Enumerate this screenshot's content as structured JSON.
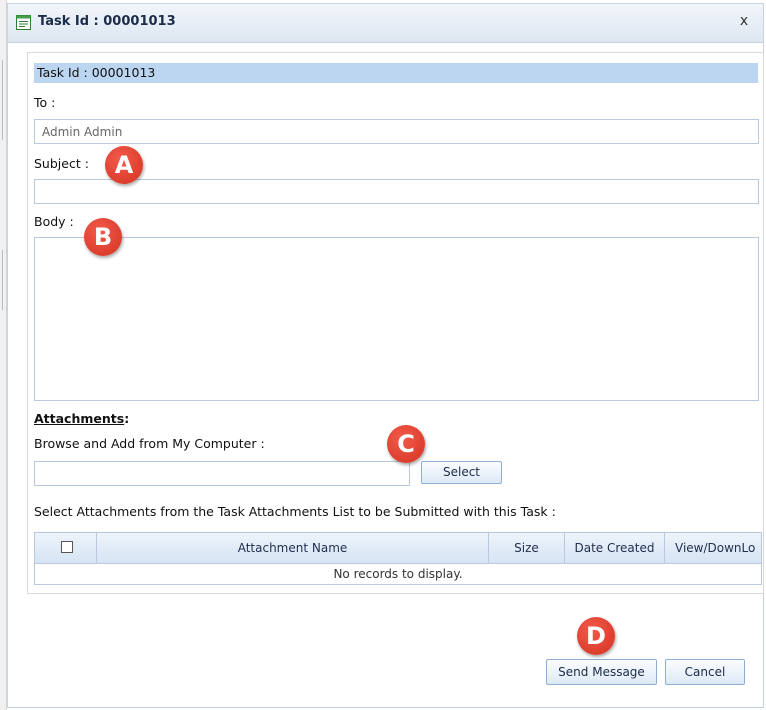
{
  "dialog": {
    "title": "Task Id : 00001013",
    "close_label": "x"
  },
  "form": {
    "task_header": "Task Id : 00001013",
    "to_label": "To :",
    "to_value": "Admin Admin",
    "subject_label": "Subject :",
    "subject_value": "",
    "body_label": "Body :",
    "body_value": "",
    "attachments_heading": "Attachments",
    "attachments_colon": ":",
    "browse_label": "Browse and Add from My Computer :",
    "browse_value": "",
    "select_button": "Select",
    "select_list_label": "Select Attachments from the Task Attachments List to be Submitted with this Task :"
  },
  "attachments_table": {
    "columns": [
      "Attachment Name",
      "Size",
      "Date Created",
      "View/DownLo"
    ],
    "empty_message": "No records to display."
  },
  "actions": {
    "send_label": "Send Message",
    "cancel_label": "Cancel"
  },
  "markers": [
    "A",
    "B",
    "C",
    "D"
  ],
  "colors": {
    "header_band": "#bcd6f2",
    "marker_red": "#e2412f",
    "field_border": "#b9c9dd"
  },
  "icons": {
    "title": "form-document-icon",
    "close": "close-icon",
    "checkbox": "checkbox-icon"
  }
}
